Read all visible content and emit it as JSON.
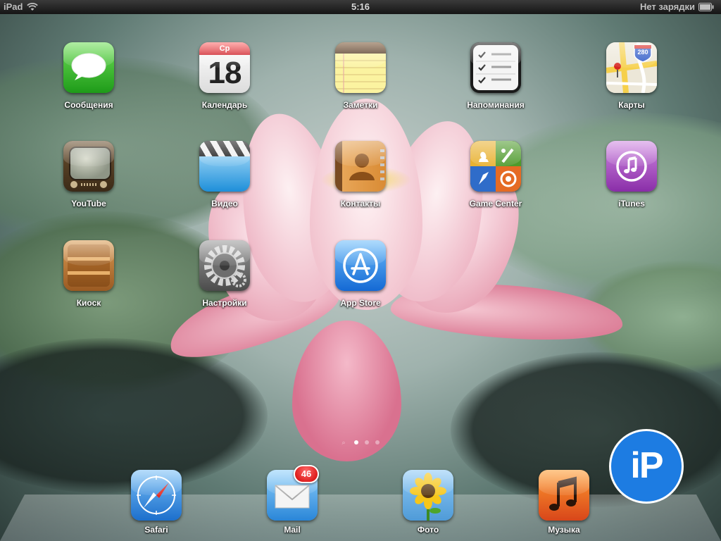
{
  "status_bar": {
    "device": "iPad",
    "time": "5:16",
    "battery_text": "Нет зарядки"
  },
  "apps": [
    {
      "name": "Сообщения"
    },
    {
      "name": "Календарь",
      "weekday": "Ср",
      "day": "18"
    },
    {
      "name": "Заметки"
    },
    {
      "name": "Напоминания"
    },
    {
      "name": "Карты",
      "road_sign": "280"
    },
    {
      "name": "YouTube"
    },
    {
      "name": "Видео"
    },
    {
      "name": "Контакты"
    },
    {
      "name": "Game Center"
    },
    {
      "name": "iTunes"
    },
    {
      "name": "Киоск"
    },
    {
      "name": "Настройки"
    },
    {
      "name": "App Store"
    }
  ],
  "dock": [
    {
      "name": "Safari"
    },
    {
      "name": "Mail",
      "badge": "46"
    },
    {
      "name": "Фото"
    },
    {
      "name": "Музыка"
    }
  ],
  "page_indicator": {
    "pages": 3,
    "current": 1,
    "has_search_page": true
  },
  "watermark": {
    "text": "iP"
  },
  "colors": {
    "status_bar": "#151515",
    "badge": "#d10000",
    "watermark": "#1d7ce2"
  }
}
